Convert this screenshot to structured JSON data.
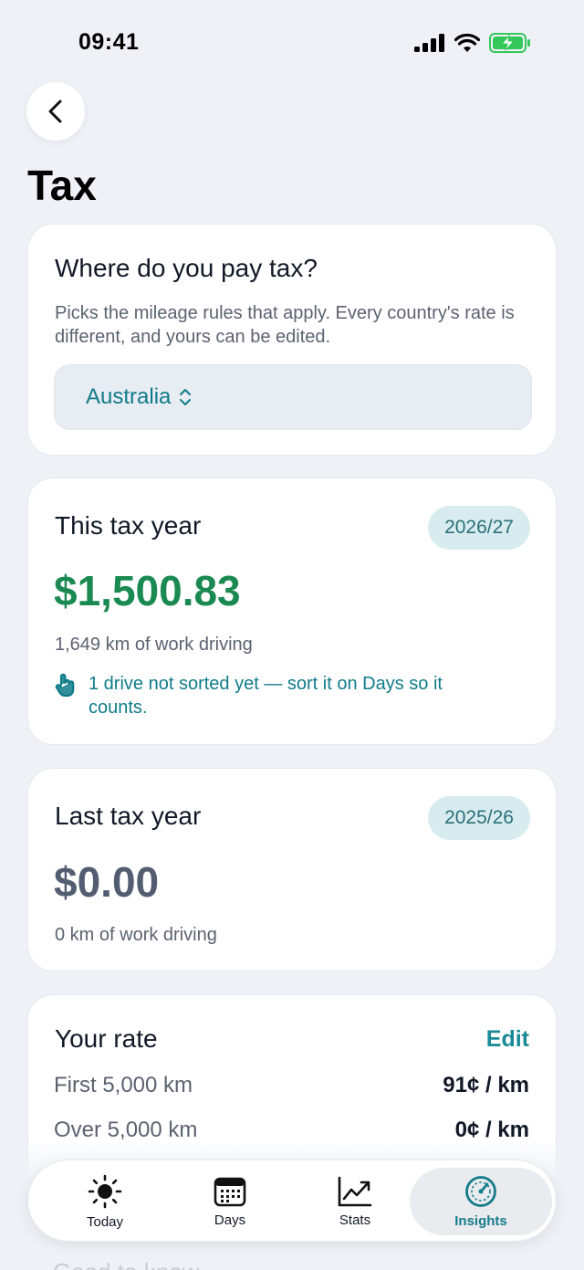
{
  "status": {
    "time": "09:41"
  },
  "page": {
    "title": "Tax"
  },
  "where": {
    "title": "Where do you pay tax?",
    "description": "Picks the mileage rules that apply. Every country's rate is different, and yours can be edited.",
    "country": "Australia"
  },
  "this_year": {
    "title": "This tax year",
    "badge": "2026/27",
    "amount": "$1,500.83",
    "distance": "1,649 km of work driving",
    "notice": "1 drive not sorted yet — sort it on Days so it counts."
  },
  "last_year": {
    "title": "Last tax year",
    "badge": "2025/26",
    "amount": "$0.00",
    "distance": "0 km of work driving"
  },
  "rate": {
    "title": "Your rate",
    "edit_label": "Edit",
    "rows": [
      {
        "label": "First 5,000 km",
        "value": "91¢ / km"
      },
      {
        "label": "Over 5,000 km",
        "value": "0¢ / km"
      }
    ]
  },
  "ghost_heading": "Good to know",
  "tabs": [
    {
      "label": "Today",
      "icon": "sun-icon"
    },
    {
      "label": "Days",
      "icon": "calendar-icon"
    },
    {
      "label": "Stats",
      "icon": "chart-icon"
    },
    {
      "label": "Insights",
      "icon": "gauge-icon",
      "active": true
    }
  ],
  "colors": {
    "accent": "#157c89",
    "positive": "#1b8a52",
    "muted_amount": "#535d72",
    "badge_bg": "#d8ecef"
  }
}
